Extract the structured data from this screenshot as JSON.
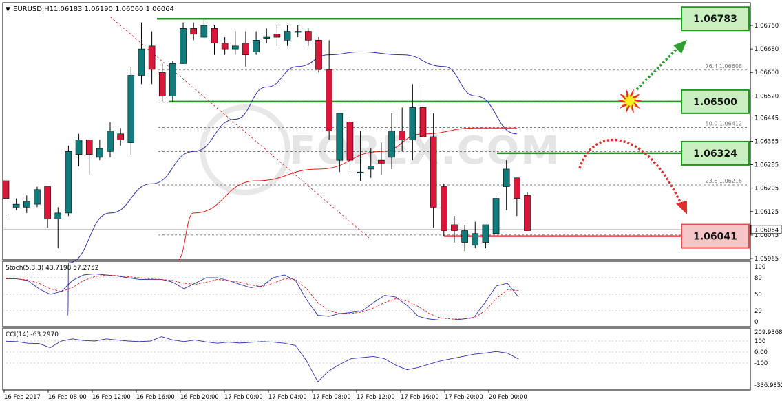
{
  "chart_data": {
    "type": "candlestick",
    "header": {
      "arrow": "▼",
      "symbol_tf": "EURUSD,H1",
      "ohlc": "1.06183 1.06190 1.06060 1.06064"
    },
    "price_axis": {
      "ticks": [
        "1.06760",
        "1.06680",
        "1.06600",
        "1.06520",
        "1.06445",
        "1.06365",
        "1.06285",
        "1.06205",
        "1.06125",
        "1.06045",
        "1.05965"
      ],
      "current_price": "1.06064"
    },
    "time_axis": {
      "ticks": [
        "16 Feb 2017",
        "16 Feb 08:00",
        "16 Feb 12:00",
        "16 Feb 16:00",
        "16 Feb 20:00",
        "17 Feb 00:00",
        "17 Feb 04:00",
        "17 Feb 08:00",
        "17 Feb 12:00",
        "17 Feb 16:00",
        "17 Feb 20:00",
        "20 Feb 00:00"
      ]
    },
    "fib_levels": [
      {
        "label": "76.4 1.06608",
        "price": 1.06608
      },
      {
        "label": "50.0 1.06412",
        "price": 1.06412
      },
      {
        "label": "23.6 1.06216",
        "price": 1.06216
      }
    ],
    "extra_dashed_levels": [
      1.06498,
      1.0633,
      1.06045
    ],
    "key_levels": [
      {
        "label": "1.06783",
        "price": 1.06783,
        "kind": "resistance"
      },
      {
        "label": "1.06500",
        "price": 1.065,
        "kind": "resistance"
      },
      {
        "label": "1.06324",
        "price": 1.06324,
        "kind": "resistance"
      },
      {
        "label": "1.06041",
        "price": 1.06041,
        "kind": "support"
      }
    ],
    "candles": [
      [
        1.0623,
        1.0617,
        1.0623,
        1.0611
      ],
      [
        1.0614,
        1.0615,
        1.0617,
        1.0613
      ],
      [
        1.0614,
        1.0616,
        1.0618,
        1.0612
      ],
      [
        1.0615,
        1.062,
        1.0621,
        1.0614
      ],
      [
        1.0621,
        1.061,
        1.0621,
        1.0607
      ],
      [
        1.061,
        1.0612,
        1.0614,
        1.06
      ],
      [
        1.0612,
        1.0633,
        1.0635,
        1.0611
      ],
      [
        1.0632,
        1.0637,
        1.0639,
        1.0628
      ],
      [
        1.0637,
        1.0632,
        1.0637,
        1.0625
      ],
      [
        1.0631,
        1.0634,
        1.0637,
        1.063
      ],
      [
        1.0633,
        1.064,
        1.0643,
        1.0631
      ],
      [
        1.0639,
        1.0637,
        1.0641,
        1.0635
      ],
      [
        1.0636,
        1.0659,
        1.0662,
        1.0632
      ],
      [
        1.0659,
        1.0668,
        1.0677,
        1.0656
      ],
      [
        1.0669,
        1.0661,
        1.0674,
        1.0656
      ],
      [
        1.066,
        1.0652,
        1.0663,
        1.065
      ],
      [
        1.0652,
        1.0663,
        1.0664,
        1.065
      ],
      [
        1.0663,
        1.0675,
        1.0677,
        1.0663
      ],
      [
        1.0675,
        1.0673,
        1.0677,
        1.0671
      ],
      [
        1.0672,
        1.0676,
        1.0678,
        1.0672
      ],
      [
        1.0675,
        1.067,
        1.0676,
        1.0666
      ],
      [
        1.067,
        1.0668,
        1.0672,
        1.0666
      ],
      [
        1.0668,
        1.0669,
        1.0674,
        1.0666
      ],
      [
        1.067,
        1.0666,
        1.0674,
        1.0662
      ],
      [
        1.0667,
        1.0671,
        1.0674,
        1.0666
      ],
      [
        1.0672,
        1.0672,
        1.0675,
        1.067
      ],
      [
        1.0673,
        1.0672,
        1.0676,
        1.0669
      ],
      [
        1.0671,
        1.0674,
        1.0676,
        1.0669
      ],
      [
        1.0674,
        1.0674,
        1.0676,
        1.0672
      ],
      [
        1.0674,
        1.0671,
        1.0675,
        1.0669
      ],
      [
        1.0671,
        1.0661,
        1.0672,
        1.066
      ],
      [
        1.0661,
        1.064,
        1.0671,
        1.0637
      ],
      [
        1.063,
        1.0646,
        1.0646,
        1.0626
      ],
      [
        1.0643,
        1.063,
        1.0644,
        1.0626
      ],
      [
        1.0626,
        1.0626,
        1.064,
        1.0623
      ],
      [
        1.0627,
        1.0628,
        1.0634,
        1.0624
      ],
      [
        1.063,
        1.0629,
        1.0636,
        1.0625
      ],
      [
        1.0631,
        1.064,
        1.0646,
        1.0627
      ],
      [
        1.064,
        1.0637,
        1.0648,
        1.0633
      ],
      [
        1.0637,
        1.0648,
        1.0656,
        1.063
      ],
      [
        1.0648,
        1.0638,
        1.0655,
        1.0632
      ],
      [
        1.0638,
        1.0614,
        1.0646,
        1.0607
      ],
      [
        1.0621,
        1.0606,
        1.0622,
        1.0604
      ],
      [
        1.0608,
        1.0606,
        1.0611,
        1.0602
      ],
      [
        1.0602,
        1.0606,
        1.0608,
        1.0599
      ],
      [
        1.0601,
        1.0605,
        1.0609,
        1.06
      ],
      [
        1.0602,
        1.0608,
        1.0608,
        1.06
      ],
      [
        1.0605,
        1.0617,
        1.0618,
        1.0605
      ],
      [
        1.0621,
        1.0627,
        1.063,
        1.0613
      ],
      [
        1.0624,
        1.0617,
        1.0624,
        1.0611
      ],
      [
        1.0618,
        1.0606,
        1.0619,
        1.0606
      ]
    ],
    "indicators": {
      "blue_ma_ticks": [
        [
          2,
          1.0577
        ],
        [
          6,
          1.0595
        ],
        [
          10,
          1.0612
        ],
        [
          14,
          1.0622
        ],
        [
          18,
          1.0633
        ],
        [
          22,
          1.0644
        ],
        [
          25,
          1.0655
        ],
        [
          28,
          1.0662
        ],
        [
          31,
          1.0666
        ],
        [
          34,
          1.0667
        ],
        [
          38,
          1.0666
        ],
        [
          42,
          1.0662
        ],
        [
          45,
          1.0652
        ],
        [
          49,
          1.0639
        ]
      ],
      "red_ma_ticks": [
        [
          12,
          1.0596
        ],
        [
          18,
          1.0612
        ],
        [
          24,
          1.0623
        ],
        [
          30,
          1.0627
        ],
        [
          36,
          1.0633
        ],
        [
          40,
          1.0639
        ],
        [
          45,
          1.0641
        ],
        [
          49,
          1.0641
        ]
      ],
      "red_trendline": {
        "from": [
          10,
          1.0679
        ],
        "to": [
          35,
          1.0603
        ]
      }
    },
    "stochastic": {
      "label": "Stoch(5,3,3) 43.7198 57.2752",
      "ticks": [
        "100",
        "80",
        "50",
        "20",
        "0"
      ],
      "main": [
        78,
        78,
        75,
        60,
        50,
        55,
        75,
        85,
        87,
        85,
        83,
        80,
        77,
        77,
        77,
        72,
        60,
        70,
        80,
        80,
        75,
        68,
        62,
        65,
        80,
        85,
        75,
        40,
        12,
        10,
        15,
        17,
        20,
        35,
        48,
        45,
        30,
        10,
        5,
        3,
        3,
        5,
        8,
        35,
        65,
        70,
        45
      ],
      "signal": [
        79,
        78,
        76,
        70,
        60,
        55,
        62,
        75,
        82,
        85,
        84,
        82,
        80,
        78,
        77,
        75,
        70,
        68,
        72,
        77,
        75,
        72,
        67,
        64,
        70,
        78,
        77,
        60,
        35,
        20,
        15,
        15,
        18,
        25,
        35,
        42,
        38,
        28,
        15,
        7,
        5,
        5,
        7,
        20,
        42,
        58,
        57
      ]
    },
    "cci": {
      "label": "CCI(14) -63.2970",
      "ticks": [
        "209.9368",
        "100",
        "0.00",
        "-100",
        "-336.9852"
      ],
      "values": [
        98,
        95,
        80,
        78,
        40,
        100,
        120,
        105,
        100,
        120,
        110,
        100,
        95,
        100,
        140,
        110,
        95,
        110,
        92,
        80,
        90,
        82,
        88,
        95,
        90,
        80,
        60,
        -80,
        -270,
        -170,
        -110,
        -60,
        -50,
        -40,
        -60,
        -120,
        -160,
        -140,
        -110,
        -80,
        -60,
        -40,
        -20,
        -10,
        5,
        -10,
        -63
      ]
    },
    "watermark": "FOREX.COM",
    "colors": {
      "bull": "#127c7c",
      "bear": "#d8183a",
      "blue_ma": "#2e33a8",
      "red_ma": "#e01c1c",
      "green_level": "#1e9a1e",
      "green_box_bg": "#c9efc0",
      "red_level": "#e24a4a",
      "red_box_bg": "#f6c6c6",
      "grid": "#555555"
    }
  }
}
